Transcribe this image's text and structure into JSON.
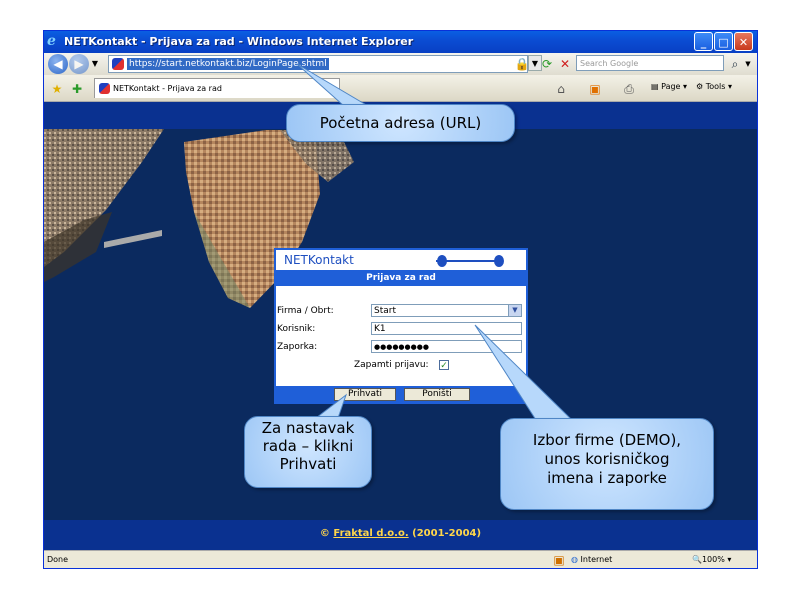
{
  "window": {
    "title": "NETKontakt - Prijava za rad - Windows Internet Explorer"
  },
  "address_bar": {
    "url": "https://start.netkontakt.biz/LoginPage.shtml"
  },
  "search": {
    "placeholder": "Search Google"
  },
  "tab": {
    "label": "NETKontakt - Prijava za rad"
  },
  "command_bar": {
    "page_label": "Page",
    "tools_label": "Tools"
  },
  "login": {
    "brand": "NETKontakt",
    "header": "Prijava za rad",
    "firma_label": "Firma / Obrt:",
    "firma_value": "Start",
    "korisnik_label": "Korisnik:",
    "korisnik_value": "K1",
    "zaporka_label": "Zaporka:",
    "zaporka_value": "●●●●●●●●●",
    "remember_label": "Zapamti prijavu:",
    "remember_checked": true,
    "accept_button": "Prihvati",
    "cancel_button": "Poništi"
  },
  "footer": {
    "copyright": "©",
    "company": "Fraktal d.o.o.",
    "years": "(2001-2004)"
  },
  "status": {
    "text": "Done",
    "zone": "Internet",
    "zoom": "100%"
  },
  "callouts": {
    "url": "Početna adresa (URL)",
    "continue": [
      "Za nastavak",
      "rada – klikni",
      "Prihvati"
    ],
    "select": [
      "Izbor firme (DEMO),",
      "unos korisničkog",
      "imena i zaporke"
    ]
  },
  "colors": {
    "accent": "#1f5fd8",
    "footer_text": "#ffd64a",
    "page_bg": "#0b2a5f"
  }
}
